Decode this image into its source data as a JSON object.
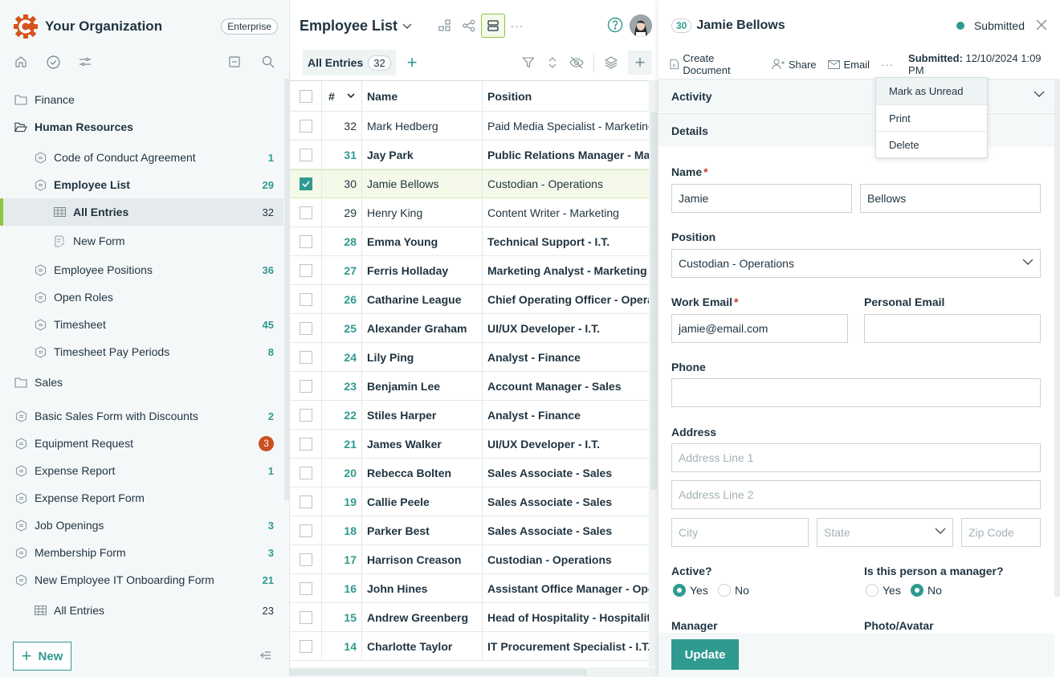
{
  "sidebar": {
    "org_name": "Your Organization",
    "plan_badge": "Enterprise",
    "new_button": "New",
    "items": [
      {
        "label": "Finance",
        "icon": "folder-icon",
        "level": 0,
        "count": ""
      },
      {
        "label": "Human Resources",
        "icon": "folder-open-icon",
        "level": 0,
        "count": "",
        "bold": true
      },
      {
        "label": "Code of Conduct Agreement",
        "icon": "form-icon",
        "level": 1,
        "count": "1"
      },
      {
        "label": "Employee List",
        "icon": "form-icon",
        "level": 1,
        "count": "29",
        "bold": true
      },
      {
        "label": "All Entries",
        "icon": "table-icon",
        "level": 2,
        "count": "32",
        "selected": true
      },
      {
        "label": "New Form",
        "icon": "form-edit-icon",
        "level": 2,
        "count": ""
      },
      {
        "label": "Employee Positions",
        "icon": "form-icon",
        "level": 1,
        "count": "36"
      },
      {
        "label": "Open Roles",
        "icon": "form-icon",
        "level": 1,
        "count": ""
      },
      {
        "label": "Timesheet",
        "icon": "form-icon",
        "level": 1,
        "count": "45"
      },
      {
        "label": "Timesheet Pay Periods",
        "icon": "form-icon",
        "level": 1,
        "count": "8"
      },
      {
        "label": "Sales",
        "icon": "folder-icon",
        "level": 0,
        "count": ""
      },
      {
        "label": "Basic Sales Form with Discounts",
        "icon": "form-icon",
        "level": 0,
        "count": "2"
      },
      {
        "label": "Equipment Request",
        "icon": "form-icon",
        "level": 0,
        "count": "3",
        "alert": true
      },
      {
        "label": "Expense Report",
        "icon": "form-icon",
        "level": 0,
        "count": "1"
      },
      {
        "label": "Expense Report Form",
        "icon": "form-icon",
        "level": 0,
        "count": ""
      },
      {
        "label": "Job Openings",
        "icon": "form-icon",
        "level": 0,
        "count": "3"
      },
      {
        "label": "Membership Form",
        "icon": "form-icon",
        "level": 0,
        "count": "3"
      },
      {
        "label": "New Employee IT Onboarding Form",
        "icon": "form-icon",
        "level": 0,
        "count": "21"
      },
      {
        "label": "All Entries",
        "icon": "table-icon",
        "level": 1,
        "count": "23"
      }
    ]
  },
  "main": {
    "title": "Employee List",
    "tab_label": "All Entries",
    "tab_count": "32",
    "columns": {
      "num": "#",
      "name": "Name",
      "position": "Position"
    },
    "rows": [
      {
        "num": "32",
        "name": "Mark Hedberg",
        "position": "Paid Media Specialist - Marketing",
        "unread": false,
        "checked": false
      },
      {
        "num": "31",
        "name": "Jay Park",
        "position": "Public Relations Manager - Marketing",
        "unread": true,
        "checked": false
      },
      {
        "num": "30",
        "name": "Jamie Bellows",
        "position": "Custodian - Operations",
        "unread": false,
        "checked": true
      },
      {
        "num": "29",
        "name": "Henry King",
        "position": "Content Writer - Marketing",
        "unread": false,
        "checked": false
      },
      {
        "num": "28",
        "name": "Emma Young",
        "position": "Technical Support - I.T.",
        "unread": true,
        "checked": false
      },
      {
        "num": "27",
        "name": "Ferris Holladay",
        "position": "Marketing Analyst - Marketing",
        "unread": true,
        "checked": false
      },
      {
        "num": "26",
        "name": "Catharine League",
        "position": "Chief Operating Officer - Operations",
        "unread": true,
        "checked": false
      },
      {
        "num": "25",
        "name": "Alexander Graham",
        "position": "UI/UX Developer - I.T.",
        "unread": true,
        "checked": false
      },
      {
        "num": "24",
        "name": "Lily Ping",
        "position": "Analyst - Finance",
        "unread": true,
        "checked": false
      },
      {
        "num": "23",
        "name": "Benjamin Lee",
        "position": "Account Manager - Sales",
        "unread": true,
        "checked": false
      },
      {
        "num": "22",
        "name": "Stiles Harper",
        "position": "Analyst - Finance",
        "unread": true,
        "checked": false
      },
      {
        "num": "21",
        "name": "James Walker",
        "position": "UI/UX Developer - I.T.",
        "unread": true,
        "checked": false
      },
      {
        "num": "20",
        "name": "Rebecca Bolten",
        "position": "Sales Associate - Sales",
        "unread": true,
        "checked": false
      },
      {
        "num": "19",
        "name": "Callie Peele",
        "position": "Sales Associate - Sales",
        "unread": true,
        "checked": false
      },
      {
        "num": "18",
        "name": "Parker Best",
        "position": "Sales Associate - Sales",
        "unread": true,
        "checked": false
      },
      {
        "num": "17",
        "name": "Harrison Creason",
        "position": "Custodian - Operations",
        "unread": true,
        "checked": false
      },
      {
        "num": "16",
        "name": "John Hines",
        "position": "Assistant Office Manager - Operations",
        "unread": true,
        "checked": false
      },
      {
        "num": "15",
        "name": "Andrew Greenberg",
        "position": "Head of Hospitality - Hospitality",
        "unread": true,
        "checked": false
      },
      {
        "num": "14",
        "name": "Charlotte Taylor",
        "position": "IT Procurement Specialist - I.T.",
        "unread": true,
        "checked": false
      }
    ]
  },
  "panel": {
    "entry_id": "30",
    "entry_name": "Jamie Bellows",
    "status": "Submitted",
    "actions": {
      "create_document": "Create Document",
      "share": "Share",
      "email": "Email"
    },
    "submitted_label": "Submitted:",
    "submitted_value": "12/10/2024 1:09 PM",
    "sections": {
      "activity": "Activity",
      "details": "Details"
    },
    "more_menu": [
      "Mark as Unread",
      "Print",
      "Delete"
    ],
    "form": {
      "name_label": "Name",
      "first_name": "Jamie",
      "last_name": "Bellows",
      "position_label": "Position",
      "position_value": "Custodian - Operations",
      "work_email_label": "Work Email",
      "work_email_value": "jamie@email.com",
      "personal_email_label": "Personal Email",
      "personal_email_value": "",
      "phone_label": "Phone",
      "phone_value": "",
      "address_label": "Address",
      "address1_placeholder": "Address Line 1",
      "address2_placeholder": "Address Line 2",
      "city_placeholder": "City",
      "state_placeholder": "State",
      "zip_placeholder": "Zip Code",
      "active_label": "Active?",
      "active_value": "Yes",
      "manager_q_label": "Is this person a manager?",
      "manager_q_value": "No",
      "yes": "Yes",
      "no": "No",
      "manager_label": "Manager",
      "photo_label": "Photo/Avatar"
    },
    "update_button": "Update"
  },
  "colors": {
    "accent": "#2f9a8f",
    "brand": "#d4541f",
    "selection": "#8dc63f",
    "alert": "#c9501f"
  }
}
